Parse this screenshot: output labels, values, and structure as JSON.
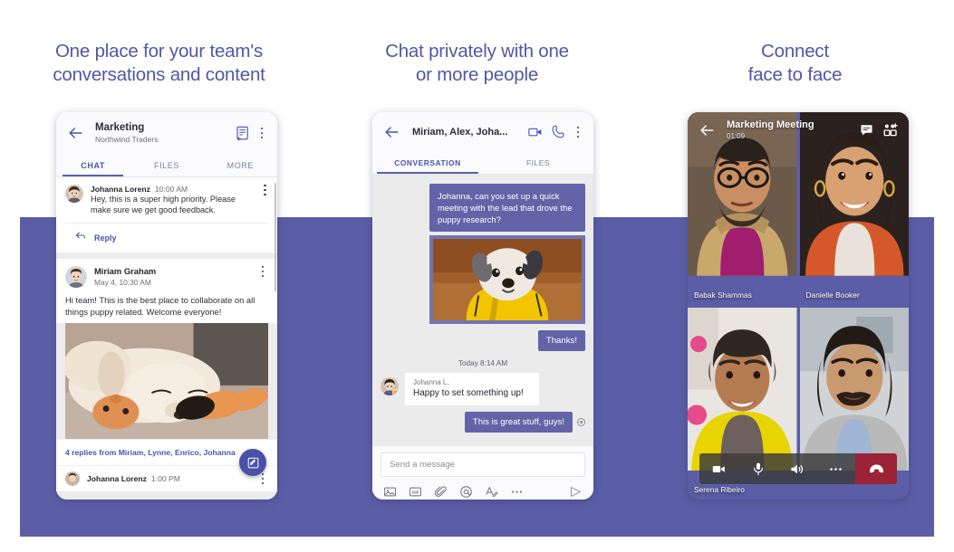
{
  "colors": {
    "band_purple": "#5b5ea6",
    "headline_purple": "#5157a6",
    "accent": "#4b53a8",
    "bubble_out": "#6264a7",
    "hangup_red": "#9b2335",
    "presence_away": "#f2a93b"
  },
  "columns": [
    {
      "headline": "One place for your team's\nconversations and content"
    },
    {
      "headline": "Chat privately with one\nor more people"
    },
    {
      "headline": "Connect\nface to face"
    }
  ],
  "phone1": {
    "header": {
      "back_icon": "back-arrow-icon",
      "title": "Marketing",
      "subtitle": "Northwind Traders",
      "compose_icon": "new-conversation-icon",
      "overflow_icon": "more-vertical-icon"
    },
    "tabs": [
      {
        "label": "CHAT",
        "active": true
      },
      {
        "label": "FILES",
        "active": false
      },
      {
        "label": "MORE",
        "active": false
      }
    ],
    "messages": [
      {
        "author": "Johanna Lorenz",
        "time": "10:00 AM",
        "text": "Hey, this is a super high priority. Please make sure we get good feedback.",
        "reply_label": "Reply",
        "reply_icon": "reply-arrow-icon"
      },
      {
        "author": "Miriam Graham",
        "time": "May 4, 10:30 AM",
        "text": "Hi team! This is the best place to collaborate on all things puppy related. Welcome everyone!",
        "image_alt": "sleeping-labrador-puppy-photo"
      }
    ],
    "replies_bar": "4 replies from Miriam, Lynne, Enrico, Johanna",
    "fab_icon": "compose-pencil-icon",
    "peek": {
      "author": "Johanna Lorenz",
      "time": "1:00 PM"
    }
  },
  "phone2": {
    "header": {
      "back_icon": "back-arrow-icon",
      "title": "Miriam, Alex, Joha...",
      "video_icon": "video-call-icon",
      "call_icon": "phone-call-icon",
      "overflow_icon": "more-vertical-icon"
    },
    "tabs": [
      {
        "label": "CONVERSATION",
        "active": true
      },
      {
        "label": "FILES",
        "active": false
      }
    ],
    "messages": [
      {
        "side": "out",
        "text": "Johanna, can you set up a quick meeting with the lead that drove the puppy research?"
      },
      {
        "side": "out",
        "type": "image",
        "image_alt": "dog-in-yellow-raincoat-photo"
      },
      {
        "side": "out",
        "text": "Thanks!"
      },
      {
        "type": "daystamp",
        "text": "Today 8:14 AM"
      },
      {
        "side": "in",
        "author": "Johanna L.",
        "text": "Happy to set something up!"
      },
      {
        "side": "out",
        "text": "This is great stuff, guys!"
      }
    ],
    "compose": {
      "placeholder": "Send a message",
      "icons": [
        "image-icon",
        "gif-icon",
        "attach-icon",
        "mention-icon",
        "format-text-icon",
        "more-horizontal-icon"
      ],
      "send_icon": "send-icon"
    }
  },
  "phone3": {
    "header": {
      "back_icon": "back-arrow-icon",
      "title": "Marketing Meeting",
      "elapsed": "01:09",
      "chat_icon": "meeting-chat-icon",
      "add_people_icon": "add-participants-icon"
    },
    "participants": [
      {
        "name": "Babak Shammas",
        "photo_alt": "man-with-glasses-video-tile"
      },
      {
        "name": "Danielle Booker",
        "photo_alt": "smiling-woman-video-tile"
      },
      {
        "name": "Serena Ribeiro",
        "photo_alt": "woman-yellow-scarf-video-tile"
      },
      {
        "name": "",
        "photo_alt": "man-curly-hair-video-tile"
      }
    ],
    "controls": [
      {
        "name": "camera-button",
        "icon": "video-camera-icon"
      },
      {
        "name": "mic-button",
        "icon": "microphone-icon"
      },
      {
        "name": "speaker-button",
        "icon": "speaker-icon"
      },
      {
        "name": "more-button",
        "icon": "more-horizontal-icon"
      },
      {
        "name": "hangup-button",
        "icon": "hangup-icon"
      }
    ]
  }
}
